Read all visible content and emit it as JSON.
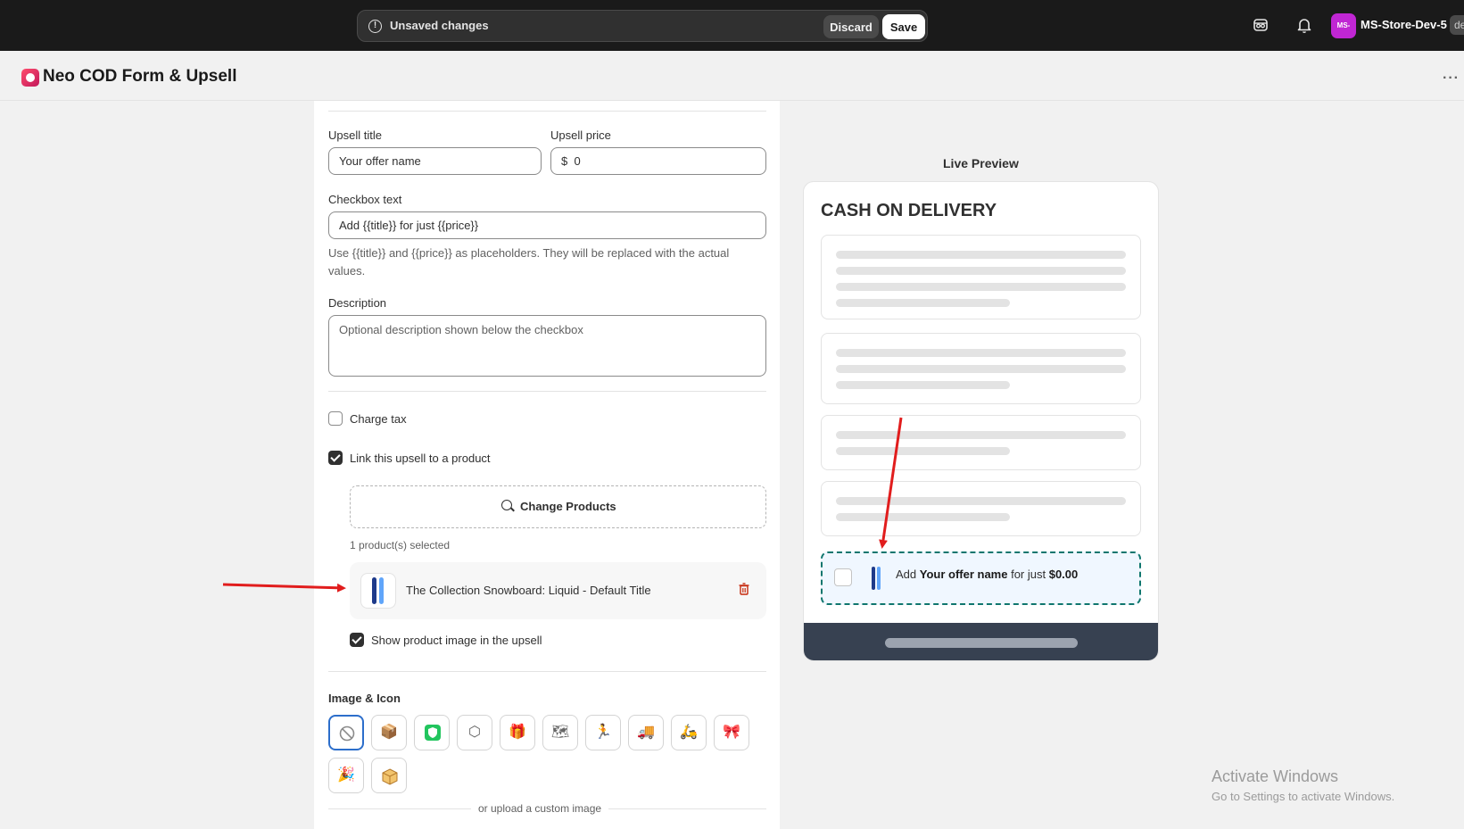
{
  "topbar": {
    "unsaved_message": "Unsaved changes",
    "discard_label": "Discard",
    "save_label": "Save",
    "store_initials": "MS-",
    "store_name": "MS-Store-Dev-5",
    "store_cut": "de"
  },
  "app": {
    "title": "Neo COD Form & Upsell",
    "more": "···"
  },
  "form": {
    "upsell_title_label": "Upsell title",
    "upsell_title_value": "Your offer name",
    "upsell_price_label": "Upsell price",
    "upsell_price_prefix": "$",
    "upsell_price_value": "0",
    "checkbox_text_label": "Checkbox text",
    "checkbox_text_value": "Add {{title}} for just {{price}}",
    "checkbox_help": "Use {{title}} and {{price}} as placeholders. They will be replaced with the actual values.",
    "description_label": "Description",
    "description_placeholder": "Optional description shown below the checkbox",
    "charge_tax_label": "Charge tax",
    "charge_tax_checked": false,
    "link_product_label": "Link this upsell to a product",
    "link_product_checked": true,
    "change_products_label": "Change Products",
    "selected_count": "1 product(s) selected",
    "product_name": "The Collection Snowboard: Liquid - Default Title",
    "show_image_label": "Show product image in the upsell",
    "show_image_checked": true,
    "image_icon_title": "Image & Icon",
    "icon_options": [
      "none-icon",
      "package-shield-icon",
      "shield-check-icon",
      "box-check-icon",
      "gift-box-icon",
      "map-icon",
      "runner-icon",
      "truck-icon",
      "delivery-icon",
      "gift-icon",
      "present-icon",
      "parcel-icon"
    ],
    "upload_text": "or upload a custom image"
  },
  "preview": {
    "label": "Live Preview",
    "heading": "CASH ON DELIVERY",
    "upsell_prefix": "Add ",
    "upsell_title": "Your offer name",
    "upsell_middle": " for just ",
    "upsell_price": "$0.00",
    "border_color": "#0f766e",
    "footer_color": "#374151"
  },
  "windows": {
    "activate": "Activate Windows",
    "activate_sub": "Go to Settings to activate Windows."
  },
  "colors": {
    "topbar": "#1a1a1a",
    "annotation_arrow": "#e11d1d",
    "selected_icon_border": "#2c6ecb"
  }
}
